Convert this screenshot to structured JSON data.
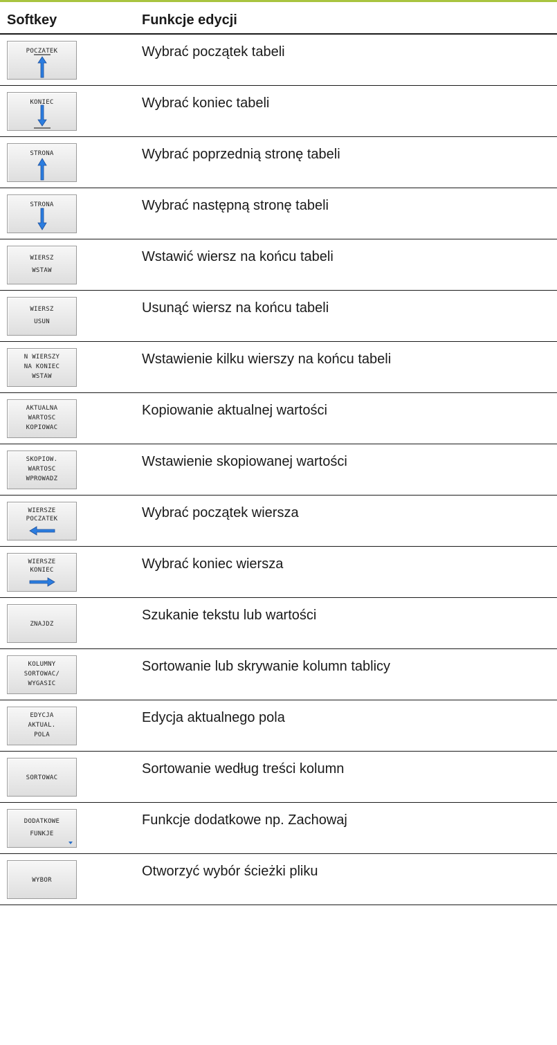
{
  "header": {
    "col_softkey": "Softkey",
    "col_function": "Funkcje edycji"
  },
  "accent_color": "#a9c43f",
  "arrow_color": "#2b7de0",
  "rows": [
    {
      "softkey": {
        "lines": [
          "POCZATEK"
        ],
        "icon": "arrow-up-to-bar-icon"
      },
      "description": "Wybrać początek tabeli"
    },
    {
      "softkey": {
        "lines": [
          "KONIEC"
        ],
        "icon": "arrow-down-to-bar-icon"
      },
      "description": "Wybrać koniec tabeli"
    },
    {
      "softkey": {
        "lines": [
          "STRONA"
        ],
        "icon": "arrow-up-icon"
      },
      "description": "Wybrać poprzednią stronę tabeli"
    },
    {
      "softkey": {
        "lines": [
          "STRONA"
        ],
        "icon": "arrow-down-icon"
      },
      "description": "Wybrać następną stronę tabeli"
    },
    {
      "softkey": {
        "lines": [
          "WIERSZ",
          "WSTAW"
        ]
      },
      "description": "Wstawić wiersz na końcu tabeli"
    },
    {
      "softkey": {
        "lines": [
          "WIERSZ",
          "USUN"
        ]
      },
      "description": "Usunąć wiersz na końcu tabeli"
    },
    {
      "softkey": {
        "lines": [
          "N WIERSZY",
          "NA KONIEC",
          "WSTAW"
        ]
      },
      "description": "Wstawienie kilku wierszy na końcu tabeli"
    },
    {
      "softkey": {
        "lines": [
          "AKTUALNA",
          "WARTOSC",
          "KOPIOWAC"
        ]
      },
      "description": "Kopiowanie aktualnej wartości"
    },
    {
      "softkey": {
        "lines": [
          "SKOPIOW.",
          "WARTOSC",
          "WPROWADZ"
        ]
      },
      "description": "Wstawienie skopiowanej wartości"
    },
    {
      "softkey": {
        "lines": [
          "WIERSZE",
          "POCZATEK"
        ],
        "icon": "arrow-left-icon"
      },
      "description": "Wybrać początek wiersza"
    },
    {
      "softkey": {
        "lines": [
          "WIERSZE",
          "KONIEC"
        ],
        "icon": "arrow-right-icon"
      },
      "description": "Wybrać koniec wiersza"
    },
    {
      "softkey": {
        "lines": [
          "ZNAJDZ"
        ]
      },
      "description": "Szukanie tekstu lub wartości"
    },
    {
      "softkey": {
        "lines": [
          "KOLUMNY",
          "SORTOWAC/",
          "WYGASIC"
        ]
      },
      "description": "Sortowanie lub skrywanie kolumn tablicy"
    },
    {
      "softkey": {
        "lines": [
          "EDYCJA",
          "AKTUAL.",
          "POLA"
        ]
      },
      "description": "Edycja aktualnego pola"
    },
    {
      "softkey": {
        "lines": [
          "SORTOWAC"
        ]
      },
      "description": "Sortowanie według treści kolumn"
    },
    {
      "softkey": {
        "lines": [
          "DODATKOWE",
          "FUNKJE"
        ],
        "icon": "dropdown-indicator-icon"
      },
      "description": "Funkcje dodatkowe np. Zachowaj"
    },
    {
      "softkey": {
        "lines": [
          "WYBOR"
        ]
      },
      "description": "Otworzyć wybór ścieżki pliku"
    }
  ]
}
